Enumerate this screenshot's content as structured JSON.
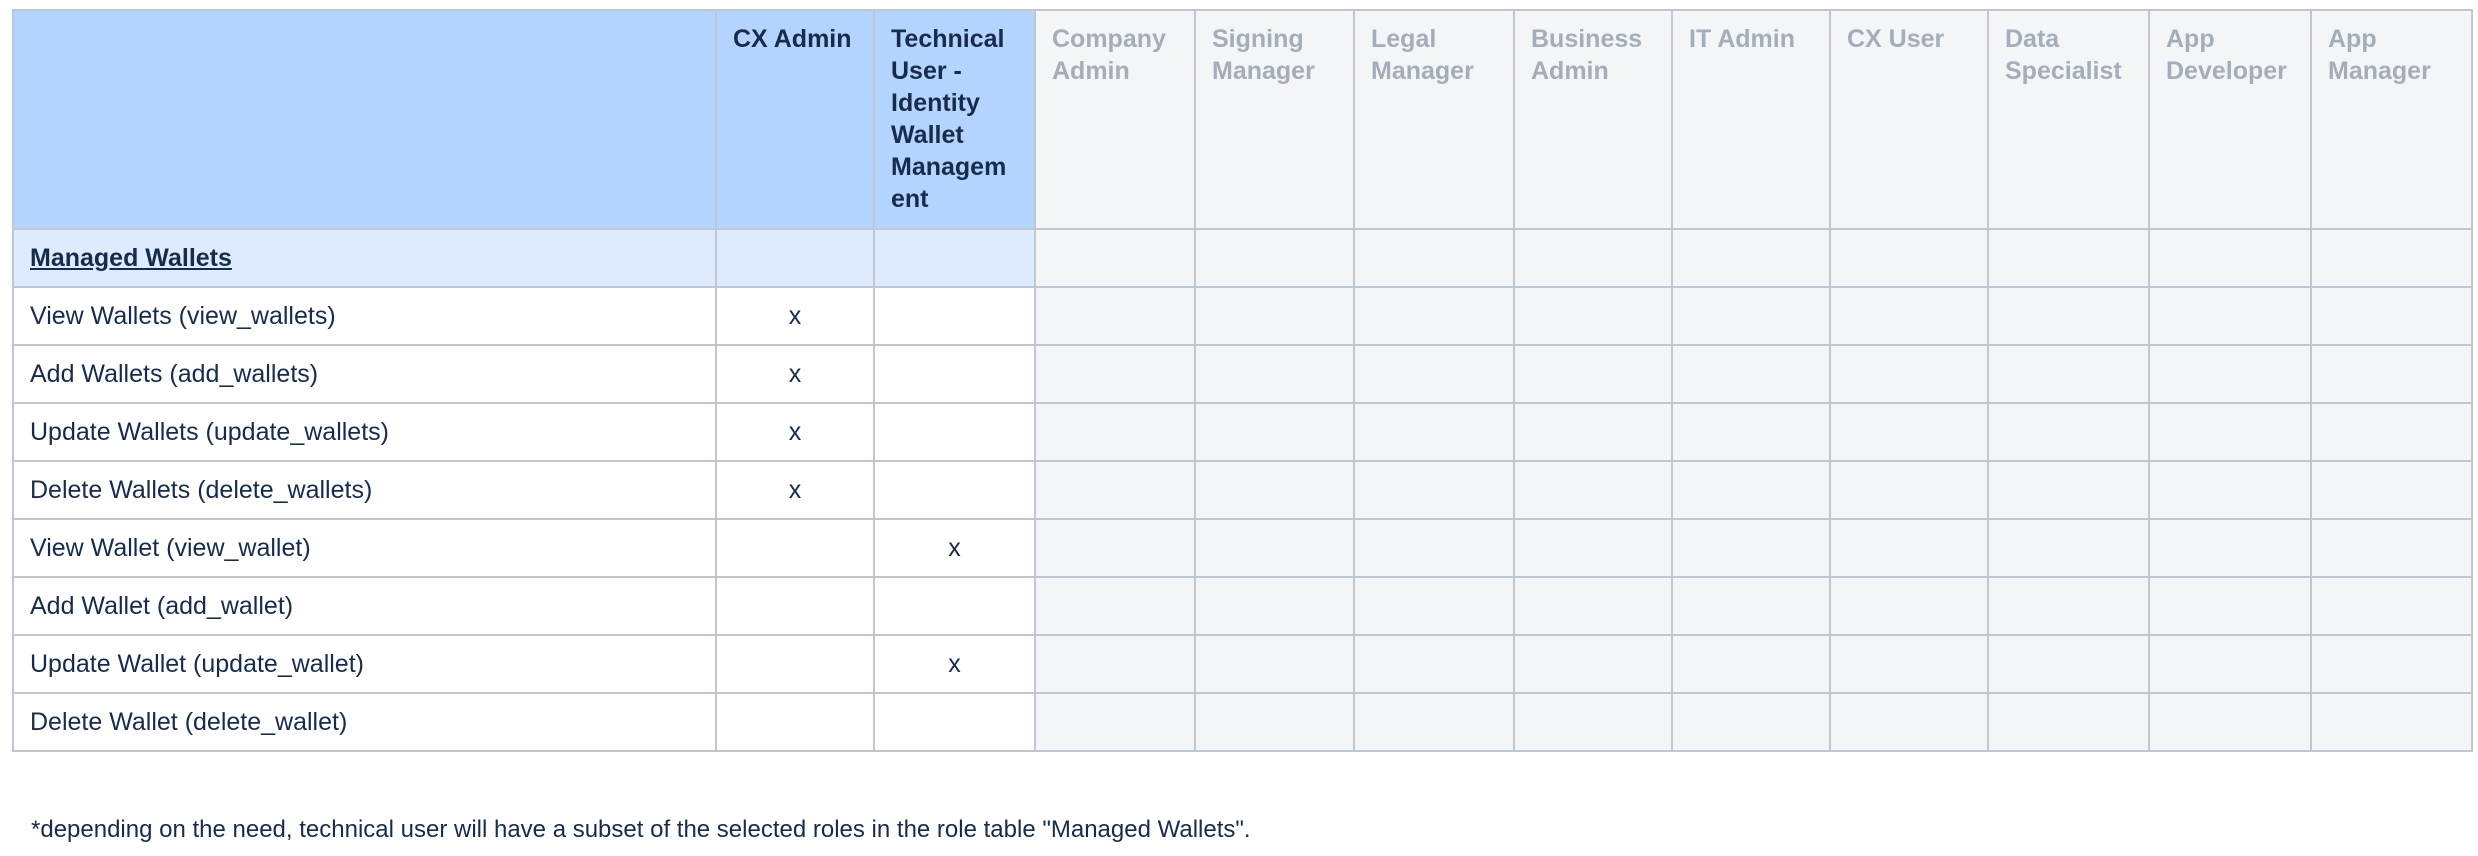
{
  "table": {
    "columns": [
      "CX Admin",
      "Technical User - Identity Wallet Managem ent",
      "Company Admin",
      "Signing Manager",
      "Legal Manager",
      "Business Admin",
      "IT Admin",
      "CX User",
      "Data Specialist",
      "App Developer",
      "App Manager"
    ],
    "section_title": "Managed Wallets",
    "rows": [
      {
        "label": "View Wallets (view_wallets)",
        "cx_admin": "x",
        "technical_user": ""
      },
      {
        "label": "Add Wallets (add_wallets)",
        "cx_admin": "x",
        "technical_user": ""
      },
      {
        "label": "Update Wallets (update_wallets)",
        "cx_admin": "x",
        "technical_user": ""
      },
      {
        "label": "Delete Wallets (delete_wallets)",
        "cx_admin": "x",
        "technical_user": ""
      },
      {
        "label": "View Wallet (view_wallet)",
        "cx_admin": "",
        "technical_user": "x"
      },
      {
        "label": "Add Wallet (add_wallet)",
        "cx_admin": "",
        "technical_user": ""
      },
      {
        "label": "Update Wallet (update_wallet)",
        "cx_admin": "",
        "technical_user": "x"
      },
      {
        "label": "Delete Wallet (delete_wallet)",
        "cx_admin": "",
        "technical_user": ""
      }
    ]
  },
  "footnote": "*depending on the need, technical user will have a subset of the selected roles in the role table \"Managed Wallets\".",
  "colors": {
    "highlight_header": "#b3d4ff",
    "highlight_section": "#deebff",
    "disabled_column": "#f4f5f7",
    "disabled_text": "#a5adba",
    "border": "#c1c7d0",
    "text": "#172b4d"
  }
}
